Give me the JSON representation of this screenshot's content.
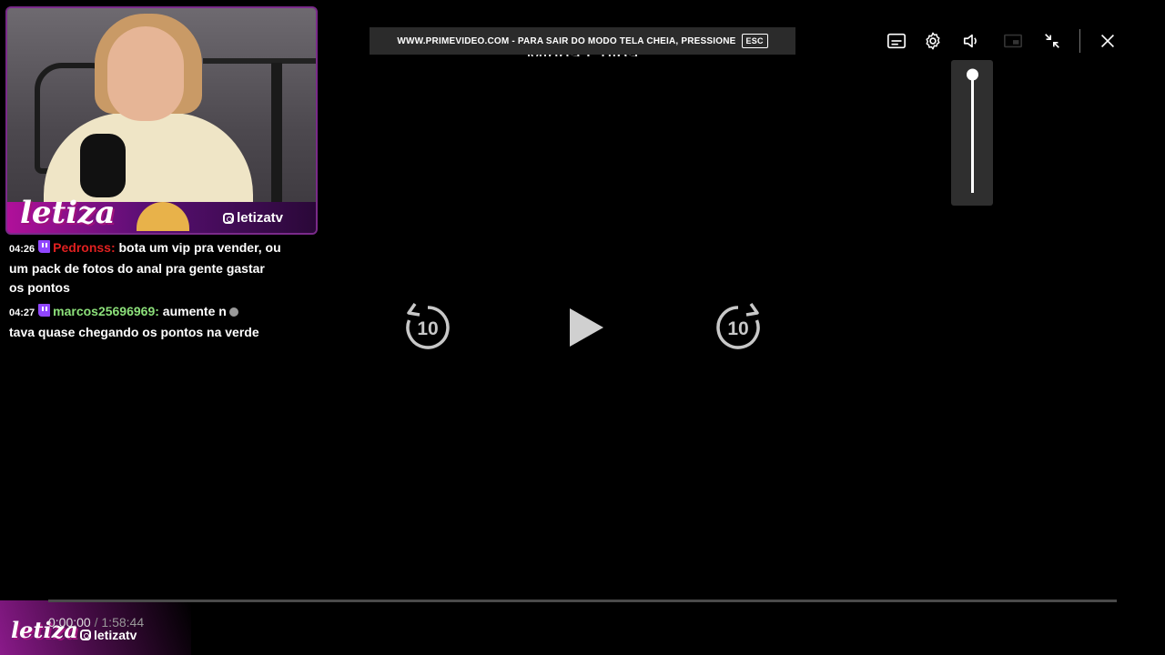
{
  "notice": {
    "text": "WWW.PRIMEVIDEO.COM - PARA SAIR DO MODO TELA CHEIA, PRESSIONE",
    "key": "ESC"
  },
  "video": {
    "title_partial": "Minha Culpa"
  },
  "overlay": {
    "logo": "letiza",
    "handle": "letizatv"
  },
  "chat": {
    "messages": [
      {
        "time": "04:26",
        "user": "Pedronss:",
        "text": "bota um vip pra vender, ou um pack de fotos do anal pra gente gastar os pontos",
        "user_color": "#e02020"
      },
      {
        "time": "04:27",
        "user": "marcos25696969:",
        "text_before": "aumente n",
        "text_after": "tava quase chegando os pontos na verde",
        "user_color": "#8ce07a"
      }
    ]
  },
  "controls": {
    "icons": [
      "subtitles-icon",
      "settings-gear-icon",
      "volume-icon",
      "picture-in-picture-icon",
      "exit-fullscreen-icon",
      "close-icon"
    ],
    "volume_level": 1.0,
    "rewind_seconds": "10",
    "forward_seconds": "10"
  },
  "playback": {
    "current_time": "0:00:00",
    "separator": " / ",
    "total_time": "1:58:44",
    "progress": 0.0
  },
  "brand": {
    "logo": "letiza",
    "handle": "letizatv"
  }
}
